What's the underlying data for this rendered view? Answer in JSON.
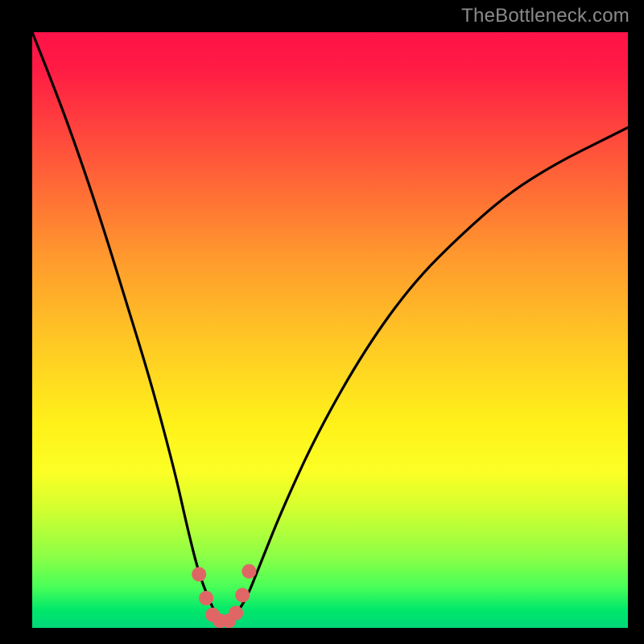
{
  "watermark": "TheBottleneck.com",
  "colors": {
    "frame_bg": "#000000",
    "curve_stroke": "#000000",
    "marker_fill": "#e06666",
    "marker_stroke": "#c44f4f",
    "watermark_text": "#8a8a8a"
  },
  "chart_data": {
    "type": "line",
    "title": "",
    "xlabel": "",
    "ylabel": "",
    "xlim": [
      0,
      100
    ],
    "ylim": [
      0,
      100
    ],
    "note": "Axes are unlabeled; x represents normalized position across plot width, y is normalized bottleneck percentage (0 = bottom/green, 100 = top/red). Values read from curve shape.",
    "series": [
      {
        "name": "bottleneck-curve",
        "x": [
          0,
          4,
          8,
          12,
          16,
          20,
          24,
          26,
          28,
          30,
          31,
          32,
          33,
          34,
          36,
          38,
          42,
          48,
          56,
          64,
          72,
          80,
          88,
          96,
          100
        ],
        "y": [
          100,
          90,
          79,
          67,
          54,
          41,
          26,
          17,
          9,
          4,
          2,
          1,
          1,
          2,
          5,
          10,
          20,
          33,
          47,
          58,
          66,
          73,
          78,
          82,
          84
        ]
      }
    ],
    "markers": {
      "description": "coral dots near the valley bottom",
      "points": [
        {
          "x": 28.0,
          "y": 9.0
        },
        {
          "x": 29.2,
          "y": 5.0
        },
        {
          "x": 30.3,
          "y": 2.2
        },
        {
          "x": 31.5,
          "y": 1.2
        },
        {
          "x": 33.0,
          "y": 1.2
        },
        {
          "x": 34.2,
          "y": 2.5
        },
        {
          "x": 35.3,
          "y": 5.5
        },
        {
          "x": 36.4,
          "y": 9.5
        }
      ],
      "radius_px": 9
    }
  }
}
